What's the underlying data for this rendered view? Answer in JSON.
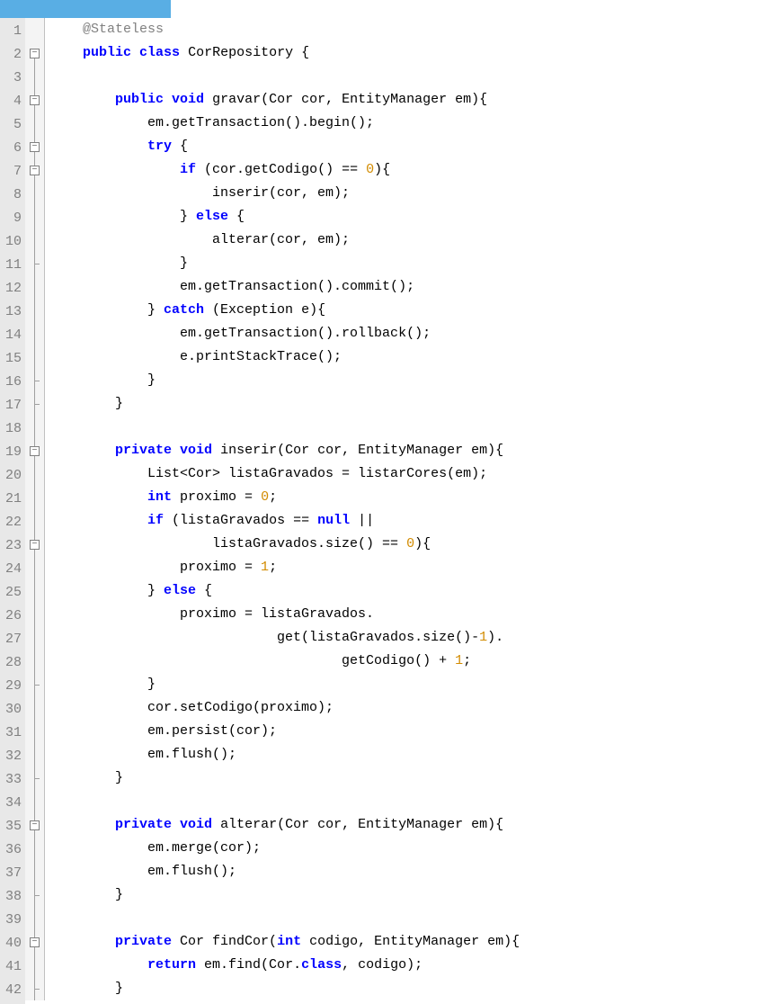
{
  "editor": {
    "lineCount": 42,
    "lines": {
      "1": "    @Stateless",
      "2": "    public class CorRepository {",
      "3": "",
      "4": "        public void gravar(Cor cor, EntityManager em){",
      "5": "            em.getTransaction().begin();",
      "6": "            try {",
      "7": "                if (cor.getCodigo() == 0){",
      "8": "                    inserir(cor, em);",
      "9": "                } else {",
      "10": "                    alterar(cor, em);",
      "11": "                }",
      "12": "                em.getTransaction().commit();",
      "13": "            } catch (Exception e){",
      "14": "                em.getTransaction().rollback();",
      "15": "                e.printStackTrace();",
      "16": "            }",
      "17": "        }",
      "18": "",
      "19": "        private void inserir(Cor cor, EntityManager em){",
      "20": "            List<Cor> listaGravados = listarCores(em);",
      "21": "            int proximo = 0;",
      "22": "            if (listaGravados == null ||",
      "23": "                    listaGravados.size() == 0){",
      "24": "                proximo = 1;",
      "25": "            } else {",
      "26": "                proximo = listaGravados.",
      "27": "                            get(listaGravados.size()-1).",
      "28": "                                    getCodigo() + 1;",
      "29": "            }",
      "30": "            cor.setCodigo(proximo);",
      "31": "            em.persist(cor);",
      "32": "            em.flush();",
      "33": "        }",
      "34": "",
      "35": "        private void alterar(Cor cor, EntityManager em){",
      "36": "            em.merge(cor);",
      "37": "            em.flush();",
      "38": "        }",
      "39": "",
      "40": "        private Cor findCor(int codigo, EntityManager em){",
      "41": "            return em.find(Cor.class, codigo);",
      "42": "        }"
    },
    "foldBoxes": [
      2,
      4,
      6,
      7,
      19,
      23,
      35,
      40
    ],
    "ticks": [
      11,
      16,
      17,
      29,
      33,
      38,
      42
    ],
    "foldSymbol": "−",
    "syntax": {
      "keywords": [
        "public",
        "class",
        "void",
        "try",
        "if",
        "else",
        "catch",
        "private",
        "int",
        "return",
        "null"
      ],
      "annotation": "@Stateless",
      "numbers": [
        "0",
        "1"
      ]
    }
  }
}
